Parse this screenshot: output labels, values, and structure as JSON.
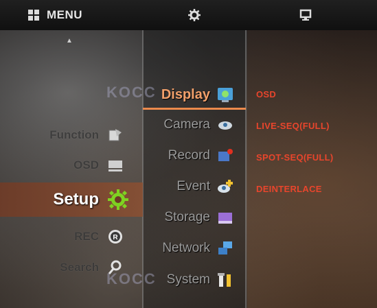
{
  "header": {
    "menu_label": "MENU",
    "menu_icon": "grid-icon",
    "settings_icon": "gear-icon",
    "display_icon": "monitor-icon"
  },
  "watermark": {
    "top": "KOCC",
    "bottom": "KOCC"
  },
  "left_menu": {
    "items": [
      {
        "label": "Function",
        "icon": "function-icon"
      },
      {
        "label": "OSD",
        "icon": "osd-icon"
      },
      {
        "label": "Setup",
        "icon": "setup-gear-icon",
        "selected": true
      },
      {
        "label": "REC",
        "icon": "rec-icon"
      },
      {
        "label": "Search",
        "icon": "search-icon"
      }
    ]
  },
  "mid_menu": {
    "items": [
      {
        "label": "Display",
        "icon": "display-icon",
        "selected": true
      },
      {
        "label": "Camera",
        "icon": "camera-icon"
      },
      {
        "label": "Record",
        "icon": "record-icon"
      },
      {
        "label": "Event",
        "icon": "event-icon"
      },
      {
        "label": "Storage",
        "icon": "storage-icon"
      },
      {
        "label": "Network",
        "icon": "network-icon"
      },
      {
        "label": "System",
        "icon": "system-icon"
      }
    ]
  },
  "right_menu": {
    "items": [
      "OSD",
      "LIVE-SEQ(FULL)",
      "SPOT-SEQ(FULL)",
      "DEINTERLACE"
    ]
  },
  "colors": {
    "accent": "#ec8a4c",
    "submenu_text": "#e8452c"
  }
}
